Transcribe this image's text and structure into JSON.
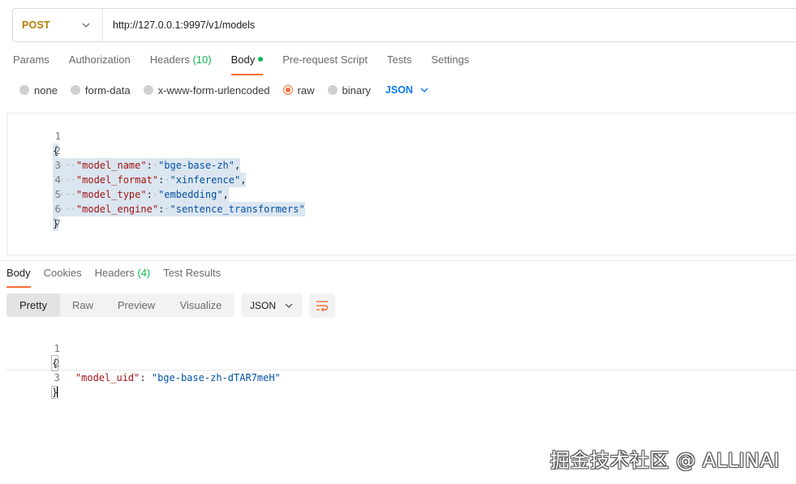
{
  "request": {
    "method": "POST",
    "url": "http://127.0.0.1:9997/v1/models"
  },
  "request_tabs": [
    {
      "label": "Params"
    },
    {
      "label": "Authorization"
    },
    {
      "label": "Headers",
      "count": "(10)"
    },
    {
      "label": "Body"
    },
    {
      "label": "Pre-request Script"
    },
    {
      "label": "Tests"
    },
    {
      "label": "Settings"
    }
  ],
  "body_types": [
    {
      "label": "none"
    },
    {
      "label": "form-data"
    },
    {
      "label": "x-www-form-urlencoded"
    },
    {
      "label": "raw",
      "selected": true
    },
    {
      "label": "binary"
    }
  ],
  "body_format": "JSON",
  "request_body_lines": [
    {
      "no": "1",
      "text": "{"
    },
    {
      "no": "2",
      "key": "\"model_name\"",
      "value": "\"bge-base-zh\""
    },
    {
      "no": "3",
      "key": "\"model_format\"",
      "value": "\"xinference\""
    },
    {
      "no": "4",
      "key": "\"model_type\"",
      "value": "\"embedding\""
    },
    {
      "no": "5",
      "key": "\"model_engine\"",
      "value": "\"sentence_transformers\""
    },
    {
      "no": "6",
      "text": "}"
    },
    {
      "no": "7",
      "text": ""
    }
  ],
  "response_tabs": [
    {
      "label": "Body"
    },
    {
      "label": "Cookies"
    },
    {
      "label": "Headers",
      "count": "(4)"
    },
    {
      "label": "Test Results"
    }
  ],
  "view_modes": [
    "Pretty",
    "Raw",
    "Preview",
    "Visualize"
  ],
  "response_format": "JSON",
  "response_body_lines": [
    {
      "no": "1",
      "text": "{"
    },
    {
      "no": "2",
      "key": "\"model_uid\"",
      "value": "\"bge-base-zh-dTAR7meH\""
    },
    {
      "no": "3",
      "text": "}"
    }
  ],
  "watermark": "掘金技术社区 @ ALLINAI",
  "colors": {
    "accent": "#ff6c37",
    "method": "#b07e00",
    "link_blue": "#097bed",
    "green": "#0cbb52"
  }
}
